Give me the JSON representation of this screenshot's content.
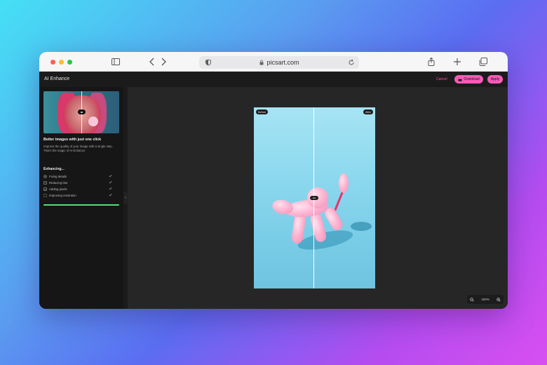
{
  "browser": {
    "url": "picsart.com"
  },
  "app": {
    "title": "AI Enhance",
    "cancel_label": "Cancel",
    "download_label": "Download",
    "apply_label": "Apply"
  },
  "sidebar": {
    "heading": "Better images with just one click",
    "description": "Improve the quality of your image with a single step. That's the magic of AI Enhance",
    "enhancing_title": "Enhancing...",
    "steps": [
      {
        "label": "Fixing details",
        "icon": "fix-icon"
      },
      {
        "label": "Reducing blur",
        "icon": "blur-icon"
      },
      {
        "label": "Adding pixels",
        "icon": "pixels-icon"
      },
      {
        "label": "Improving resolution",
        "icon": "resolution-icon"
      }
    ],
    "progress": 1.0
  },
  "canvas": {
    "before_label": "Before",
    "after_label": "After",
    "zoom_level": "100%"
  },
  "colors": {
    "accent": "#f85bb6",
    "progress": "#4fe07a",
    "cancel": "#ff4fa3"
  }
}
